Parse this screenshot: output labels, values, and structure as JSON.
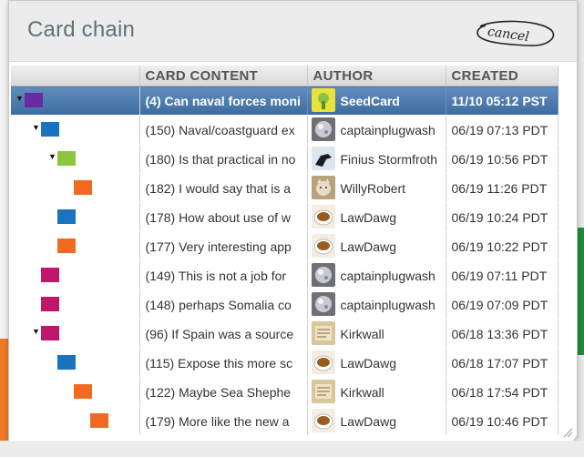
{
  "popup": {
    "title": "Card chain",
    "cancel_label": "cancel"
  },
  "table": {
    "headers": [
      "CARD CONTENT",
      "AUTHOR",
      "CREATED"
    ],
    "rows": [
      {
        "depth": 0,
        "expanded": true,
        "color": "#6a2aa0",
        "content": "(4) Can naval forces moni",
        "author": "SeedCard",
        "avatar": "seed-card-avatar",
        "created": "11/10 05:12 PST",
        "selected": true
      },
      {
        "depth": 1,
        "expanded": true,
        "color": "#1a73c0",
        "content": "(150) Naval/coastguard ex",
        "author": "captainplugwash",
        "avatar": "silver-ornament-avatar",
        "created": "06/19 07:13 PDT",
        "selected": false
      },
      {
        "depth": 2,
        "expanded": true,
        "color": "#8cc63f",
        "content": "(180) Is that practical in no",
        "author": "Finius Stormfroth",
        "avatar": "crow-avatar",
        "created": "06/19 10:56 PDT",
        "selected": false
      },
      {
        "depth": 3,
        "expanded": false,
        "color": "#f26a22",
        "content": "(182) I would say that is a",
        "author": "WillyRobert",
        "avatar": "cat-avatar",
        "created": "06/19 11:26 PDT",
        "selected": false
      },
      {
        "depth": 2,
        "expanded": false,
        "color": "#1a73c0",
        "content": "(178) How about use of w",
        "author": "LawDawg",
        "avatar": "tea-cup-avatar",
        "created": "06/19 10:24 PDT",
        "selected": false
      },
      {
        "depth": 2,
        "expanded": false,
        "color": "#f26a22",
        "content": "(177) Very interesting app",
        "author": "LawDawg",
        "avatar": "tea-cup-avatar",
        "created": "06/19 10:22 PDT",
        "selected": false
      },
      {
        "depth": 1,
        "expanded": false,
        "color": "#c0176b",
        "content": "(149) This is not a job for",
        "author": "captainplugwash",
        "avatar": "silver-ornament-avatar",
        "created": "06/19 07:11 PDT",
        "selected": false
      },
      {
        "depth": 1,
        "expanded": false,
        "color": "#c0176b",
        "content": "(148) perhaps Somalia co",
        "author": "captainplugwash",
        "avatar": "silver-ornament-avatar",
        "created": "06/19 07:09 PDT",
        "selected": false
      },
      {
        "depth": 1,
        "expanded": true,
        "color": "#c0176b",
        "content": "(96) If Spain was a source",
        "author": "Kirkwall",
        "avatar": "document-avatar",
        "created": "06/18 13:36 PDT",
        "selected": false
      },
      {
        "depth": 2,
        "expanded": false,
        "color": "#1a73c0",
        "content": "(115) Expose this more sc",
        "author": "LawDawg",
        "avatar": "tea-cup-avatar",
        "created": "06/18 17:07 PDT",
        "selected": false
      },
      {
        "depth": 3,
        "expanded": false,
        "color": "#f26a22",
        "content": "(122) Maybe Sea Shephe",
        "author": "Kirkwall",
        "avatar": "document-avatar",
        "created": "06/18 17:54 PDT",
        "selected": false
      },
      {
        "depth": 4,
        "expanded": false,
        "color": "#f26a22",
        "content": "(179) More like the new a",
        "author": "LawDawg",
        "avatar": "tea-cup-avatar",
        "created": "06/19 10:46 PDT",
        "selected": false
      }
    ]
  }
}
